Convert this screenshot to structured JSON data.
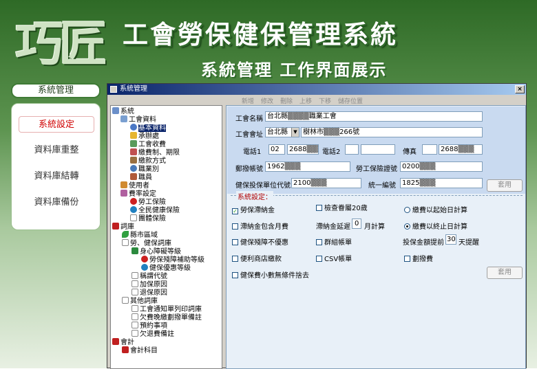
{
  "header": {
    "logo": "巧匠",
    "title": "工會勞保健保管理系統",
    "subtitle": "系統管理  工作界面展示"
  },
  "sidebar": {
    "header": "系統管理",
    "items": [
      {
        "label": "系統設定"
      },
      {
        "label": "資料庫重整"
      },
      {
        "label": "資料庫結轉"
      },
      {
        "label": "資料庫備份"
      }
    ]
  },
  "window": {
    "title": "系統管理",
    "close": "×",
    "toolbar": [
      "新增",
      "修改",
      "刪除",
      "上移",
      "下移",
      "儲存位置"
    ]
  },
  "tree": [
    {
      "label": "系統"
    },
    {
      "label": "工會資料"
    },
    {
      "label": "基本資料"
    },
    {
      "label": "承辦處"
    },
    {
      "label": "工會收費"
    },
    {
      "label": "繳費制、期限"
    },
    {
      "label": "繳款方式"
    },
    {
      "label": "職業別"
    },
    {
      "label": "職員"
    },
    {
      "label": "使用者"
    },
    {
      "label": "費率設定"
    },
    {
      "label": "勞工保險"
    },
    {
      "label": "全民健康保險"
    },
    {
      "label": "團體保險"
    },
    {
      "label": "詞庫"
    },
    {
      "label": "縣市區域"
    },
    {
      "label": "勞、健保詞庫"
    },
    {
      "label": "身心障礙等級"
    },
    {
      "label": "勞保殘障補助等級"
    },
    {
      "label": "健保優惠等級"
    },
    {
      "label": "稱謂代號"
    },
    {
      "label": "加保原因"
    },
    {
      "label": "退保原因"
    },
    {
      "label": "其他詞庫"
    },
    {
      "label": "工會通知單列印詞庫"
    },
    {
      "label": "欠費晚繳劃撥單備註"
    },
    {
      "label": "預約事項"
    },
    {
      "label": "欠退費備註"
    },
    {
      "label": "會計"
    },
    {
      "label": "會計科目"
    }
  ],
  "form": {
    "union_name_label": "工會名稱",
    "union_name_value": "台北縣▒▒▒▒職業工會",
    "address_label": "工會會址",
    "address_city": "台北縣",
    "address_value": "樹林市▒▒▒266號",
    "phone1_label": "電話1",
    "phone1_area": "02",
    "phone1_value": "2688▒▒▒",
    "phone2_label": "電話2",
    "phone2_area": "",
    "phone2_value": "",
    "fax_label": "傳真",
    "fax_area": "",
    "fax_value": "2688▒▒▒",
    "postal_label": "郵撥帳號",
    "postal_value": "1962▒▒▒",
    "labor_label": "勞工保險證號",
    "labor_value": "0200▒▒▒",
    "health_label": "健保投保單位代號",
    "health_value": "2100▒▒▒",
    "tax_label": "統一編號",
    "tax_value": "1825▒▒▒",
    "apply1": "套用",
    "apply2": "套用",
    "settings_label": "系統設定：",
    "chk_late_fee": "勞保滯納金",
    "chk_check_dep": "檢查眷屬20歲",
    "radio_start": "繳費以起始日計算",
    "chk_late_incl": "滯納金包含月費",
    "late_delay_prefix": "滯納金延遲",
    "late_delay_value": "0",
    "late_delay_suffix": "月計算",
    "radio_end": "繳費以終止日計算",
    "chk_disability": "健保殘障不優惠",
    "chk_group_bill": "群組帳單",
    "reminder_prefix": "投保金額提前",
    "reminder_value": "30",
    "reminder_suffix": "天提醒",
    "chk_convenience": "便利商店繳款",
    "chk_csv": "CSV帳單",
    "chk_transfer_fee": "劃撥費",
    "chk_round": "健保費小數無條件捨去",
    "late_fee_checked": "✓"
  }
}
